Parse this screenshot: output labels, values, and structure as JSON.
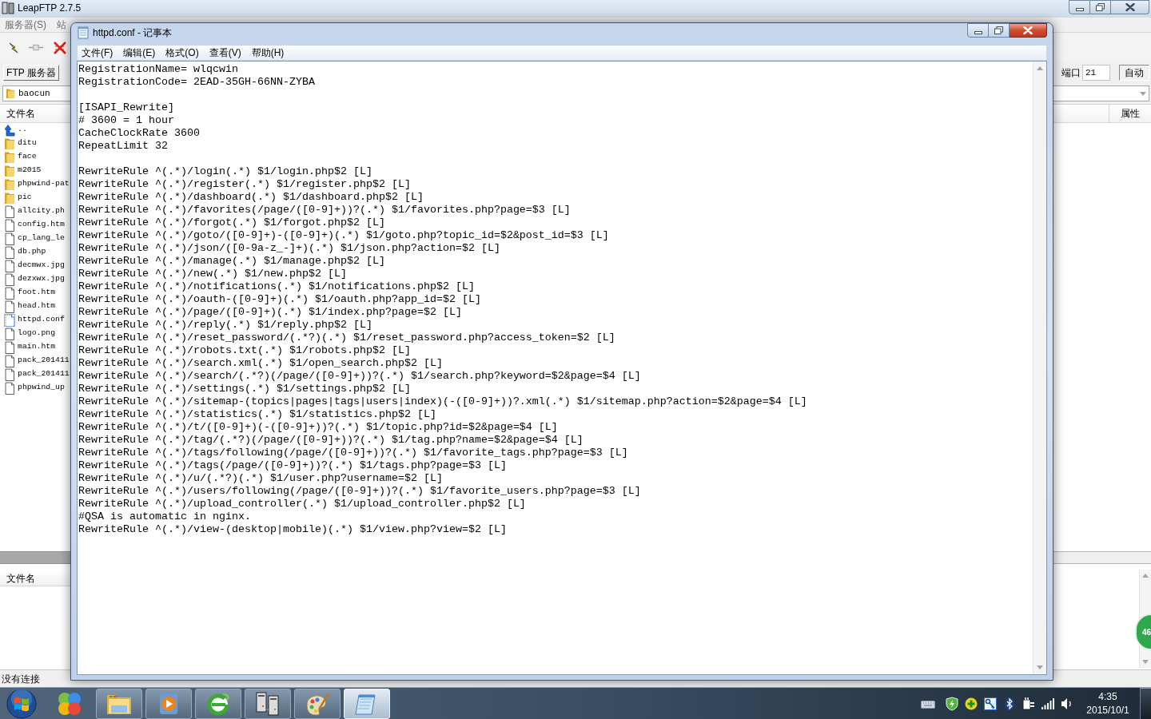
{
  "leapftp": {
    "window": {
      "title": "LeapFTP 2.7.5"
    },
    "menu": [
      "服务器(S)",
      "站"
    ],
    "toolbar": {
      "server_button": "FTP 服务器",
      "port": {
        "label": "端口",
        "value": "21"
      },
      "auto_button": "自动"
    },
    "path": {
      "value": "baocun"
    },
    "local_files": {
      "columns": [
        "文件名"
      ],
      "items": [
        {
          "name": "..",
          "kind": "up",
          "selected": false
        },
        {
          "name": "ditu",
          "kind": "folder",
          "selected": false
        },
        {
          "name": "face",
          "kind": "folder",
          "selected": false
        },
        {
          "name": "m2015",
          "kind": "folder",
          "selected": false
        },
        {
          "name": "phpwind-pat",
          "kind": "folder",
          "selected": false
        },
        {
          "name": "pic",
          "kind": "folder",
          "selected": false
        },
        {
          "name": "allcity.ph",
          "kind": "file",
          "selected": false
        },
        {
          "name": "config.htm",
          "kind": "file",
          "selected": false
        },
        {
          "name": "cp_lang_le",
          "kind": "file",
          "selected": false
        },
        {
          "name": "db.php",
          "kind": "file",
          "selected": false
        },
        {
          "name": "decmwx.jpg",
          "kind": "file",
          "selected": false
        },
        {
          "name": "dezxwx.jpg",
          "kind": "file",
          "selected": false
        },
        {
          "name": "foot.htm",
          "kind": "file",
          "selected": false
        },
        {
          "name": "head.htm",
          "kind": "file",
          "selected": false
        },
        {
          "name": "httpd.conf",
          "kind": "file",
          "selected": true
        },
        {
          "name": "logo.png",
          "kind": "file",
          "selected": false
        },
        {
          "name": "main.htm",
          "kind": "file",
          "selected": false
        },
        {
          "name": "pack_201411",
          "kind": "file",
          "selected": false
        },
        {
          "name": "pack_201411",
          "kind": "file",
          "selected": false
        },
        {
          "name": "phpwind_up",
          "kind": "file",
          "selected": false
        }
      ]
    },
    "remote_files": {
      "columns": [
        "属性"
      ]
    },
    "queue": {
      "columns": [
        "文件名"
      ]
    },
    "status_bar": "没有连接"
  },
  "notepad": {
    "window": {
      "title": "httpd.conf - 记事本"
    },
    "menu": [
      "文件(F)",
      "编辑(E)",
      "格式(O)",
      "查看(V)",
      "帮助(H)"
    ],
    "paragraphs": [
      [
        "RegistrationName= wlqcwin",
        "RegistrationCode= 2EAD-35GH-66NN-ZYBA"
      ],
      [
        "[ISAPI_Rewrite]",
        "# 3600 = 1 hour",
        "CacheClockRate 3600",
        "RepeatLimit 32"
      ],
      [
        "RewriteRule ^(.*)/login(.*) $1/login.php$2 [L]",
        "RewriteRule ^(.*)/register(.*) $1/register.php$2 [L]",
        "RewriteRule ^(.*)/dashboard(.*) $1/dashboard.php$2 [L]",
        "RewriteRule ^(.*)/favorites(/page/([0-9]+))?(.*) $1/favorites.php?page=$3 [L]",
        "RewriteRule ^(.*)/forgot(.*) $1/forgot.php$2 [L]",
        "RewriteRule ^(.*)/goto/([0-9]+)-([0-9]+)(.*) $1/goto.php?topic_id=$2&post_id=$3 [L]",
        "RewriteRule ^(.*)/json/([0-9a-z_-]+)(.*) $1/json.php?action=$2 [L]",
        "RewriteRule ^(.*)/manage(.*) $1/manage.php$2 [L]",
        "RewriteRule ^(.*)/new(.*) $1/new.php$2 [L]",
        "RewriteRule ^(.*)/notifications(.*) $1/notifications.php$2 [L]",
        "RewriteRule ^(.*)/oauth-([0-9]+)(.*) $1/oauth.php?app_id=$2 [L]",
        "RewriteRule ^(.*)/page/([0-9]+)(.*) $1/index.php?page=$2 [L]",
        "RewriteRule ^(.*)/reply(.*) $1/reply.php$2 [L]",
        "RewriteRule ^(.*)/reset_password/(.*?)(.*) $1/reset_password.php?access_token=$2 [L]",
        "RewriteRule ^(.*)/robots.txt(.*) $1/robots.php$2 [L]",
        "RewriteRule ^(.*)/search.xml(.*) $1/open_search.php$2 [L]",
        "RewriteRule ^(.*)/search/(.*?)(/page/([0-9]+))?(.*) $1/search.php?keyword=$2&page=$4 [L]",
        "RewriteRule ^(.*)/settings(.*) $1/settings.php$2 [L]",
        "RewriteRule ^(.*)/sitemap-(topics|pages|tags|users|index)(-([0-9]+))?.xml(.*) $1/sitemap.php?action=$2&page=$4 [L]",
        "RewriteRule ^(.*)/statistics(.*) $1/statistics.php$2 [L]",
        "RewriteRule ^(.*)/t/([0-9]+)(-([0-9]+))?(.*) $1/topic.php?id=$2&page=$4 [L]",
        "RewriteRule ^(.*)/tag/(.*?)(/page/([0-9]+))?(.*) $1/tag.php?name=$2&page=$4 [L]",
        "RewriteRule ^(.*)/tags/following(/page/([0-9]+))?(.*) $1/favorite_tags.php?page=$3 [L]",
        "RewriteRule ^(.*)/tags(/page/([0-9]+))?(.*) $1/tags.php?page=$3 [L]",
        "RewriteRule ^(.*)/u/(.*?)(.*) $1/user.php?username=$2 [L]",
        "RewriteRule ^(.*)/users/following(/page/([0-9]+))?(.*) $1/favorite_users.php?page=$3 [L]",
        "RewriteRule ^(.*)/upload_controller(.*) $1/upload_controller.php$2 [L]",
        "#QSA is automatic in nginx.",
        "RewriteRule ^(.*)/view-(desktop|mobile)(.*) $1/view.php?view=$2 [L]"
      ]
    ]
  },
  "speed_ball": {
    "value": "46"
  },
  "taskbar": {
    "buttons": [
      {
        "running": false,
        "selected": false
      },
      {
        "running": true,
        "selected": false
      },
      {
        "running": true,
        "selected": false
      },
      {
        "running": true,
        "selected": false
      },
      {
        "running": true,
        "selected": false
      },
      {
        "running": true,
        "selected": false
      },
      {
        "running": true,
        "selected": true
      }
    ],
    "clock": {
      "time": "4:35",
      "date": "2015/10/1"
    }
  }
}
